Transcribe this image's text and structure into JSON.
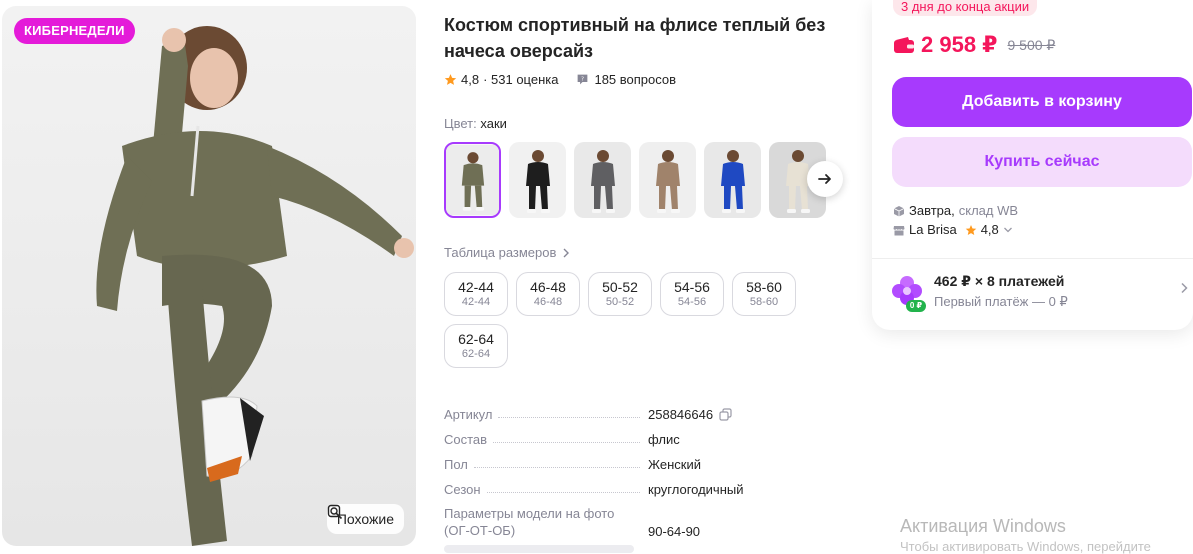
{
  "gallery": {
    "badge": "КИБЕРНЕДЕЛИ",
    "similar_label": "Похожие"
  },
  "product": {
    "title": "Костюм спортивный на флисе теплый без начеса оверсайз",
    "rating": "4,8",
    "ratings_count": "· 531 оценка",
    "questions": "185 вопросов",
    "color_label": "Цвет:",
    "color_value": "хаки",
    "color_thumbs": [
      {
        "name": "хаки",
        "suit": "#6f6f55",
        "bg": "#ececec"
      },
      {
        "name": "черный",
        "suit": "#1e1e1e",
        "bg": "#f1f1f1"
      },
      {
        "name": "серый",
        "suit": "#5f5f62",
        "bg": "#e9e9e9"
      },
      {
        "name": "бежевый",
        "suit": "#a0836b",
        "bg": "#efefef"
      },
      {
        "name": "синий",
        "suit": "#1f49c2",
        "bg": "#e8e8e8"
      },
      {
        "name": "молочный",
        "suit": "#e7e1d4",
        "bg": "#d9d9d9"
      }
    ],
    "size_table_link": "Таблица размеров",
    "sizes": [
      {
        "main": "42-44",
        "sub": "42-44"
      },
      {
        "main": "46-48",
        "sub": "46-48"
      },
      {
        "main": "50-52",
        "sub": "50-52"
      },
      {
        "main": "54-56",
        "sub": "54-56"
      },
      {
        "main": "58-60",
        "sub": "58-60"
      },
      {
        "main": "62-64",
        "sub": "62-64"
      }
    ],
    "params": [
      {
        "key": "Артикул",
        "value": "258846646"
      },
      {
        "key": "Состав",
        "value": "флис"
      },
      {
        "key": "Пол",
        "value": "Женский"
      },
      {
        "key": "Сезон",
        "value": "круглогодичный"
      },
      {
        "key": "Параметры модели на фото (ОГ-ОТ-ОБ)",
        "value": "90-64-90"
      }
    ]
  },
  "buy": {
    "promo": "3 дня до конца акции",
    "price": "2 958 ₽",
    "old_price": "9 500 ₽",
    "add_to_cart": "Добавить в корзину",
    "buy_now": "Купить сейчас",
    "delivery_day": "Завтра,",
    "delivery_stock": "склад WB",
    "seller": "La Brisa",
    "seller_rating": "4,8",
    "installment": "462 ₽ × 8 платежей",
    "first_payment": "Первый платёж — 0 ₽",
    "installment_badge": "0 ₽"
  },
  "os": {
    "watermark_title": "Активация Windows",
    "watermark_sub": "Чтобы активировать Windows, перейдите"
  },
  "colors": {
    "accent": "#a73afd",
    "accent_light": "#f4dcfc",
    "price": "#f4165b",
    "badge": "#e41bd9",
    "star": "#ff9a1f"
  }
}
